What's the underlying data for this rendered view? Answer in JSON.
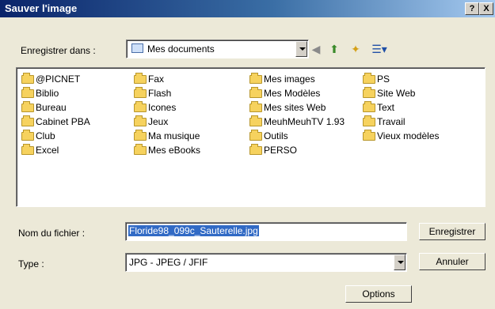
{
  "window": {
    "title": "Sauver l'image",
    "help_label": "?",
    "close_label": "X"
  },
  "location": {
    "label": "Enregistrer dans :",
    "value": "Mes documents"
  },
  "toolbar": {
    "back_icon": "back-arrow-icon",
    "up_icon": "up-folder-icon",
    "new_folder_icon": "new-folder-icon",
    "view_icon": "view-menu-icon"
  },
  "files": {
    "col1": [
      "@PICNET",
      "Biblio",
      "Bureau",
      "Cabinet PBA",
      "Club",
      "Excel"
    ],
    "col2": [
      "Fax",
      "Flash",
      "Icones",
      "Jeux",
      "Ma musique",
      "Mes eBooks"
    ],
    "col3": [
      "Mes images",
      "Mes Modèles",
      "Mes sites Web",
      "MeuhMeuhTV 1.93",
      "Outils",
      "PERSO"
    ],
    "col4": [
      "PS",
      "Site Web",
      "Text",
      "Travail",
      "Vieux modèles"
    ]
  },
  "filename": {
    "label": "Nom du fichier :",
    "value": "Floride98_099c_Sauterelle.jpg"
  },
  "filetype": {
    "label": "Type :",
    "value": "JPG - JPEG / JFIF"
  },
  "buttons": {
    "save": "Enregistrer",
    "cancel": "Annuler",
    "options": "Options"
  },
  "colors": {
    "selection": "#316ac5",
    "folder": "#f6d25e",
    "dialog_bg": "#ece9d8"
  }
}
